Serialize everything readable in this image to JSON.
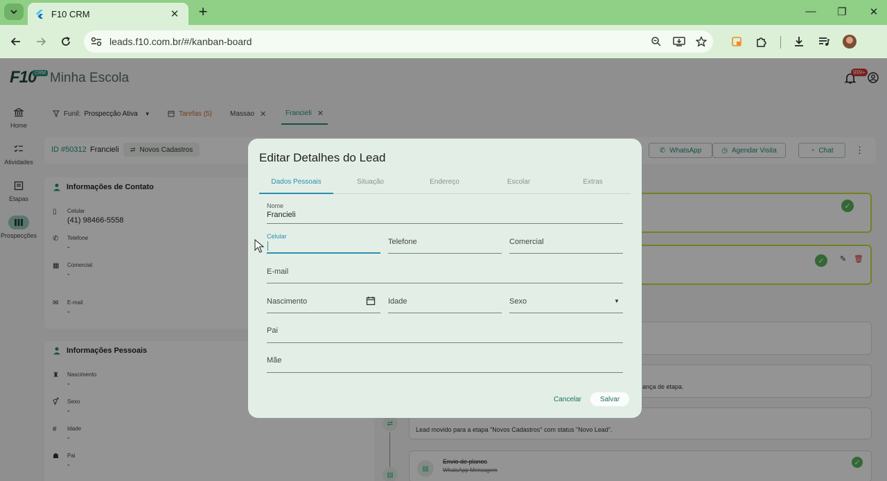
{
  "browser": {
    "tab_title": "F10 CRM",
    "url": "leads.f10.com.br/#/kanban-board"
  },
  "app": {
    "logo_text": "F10",
    "logo_badge": "CRM",
    "title": "Minha Escola",
    "notification_count": "999+",
    "sidebar": [
      {
        "label": "Home",
        "icon": "bank-icon"
      },
      {
        "label": "Atividades",
        "icon": "checklist-icon"
      },
      {
        "label": "Etapas",
        "icon": "board-icon"
      },
      {
        "label": "Prospecções",
        "icon": "columns-icon"
      }
    ],
    "tabs": {
      "funnel_label": "Funil:",
      "funnel_value": "Prospecção Ativa",
      "tarefas": "Tarefas (5)",
      "massao": "Massao",
      "francieli": "Francieli"
    },
    "lead": {
      "id": "ID #50312",
      "name": "Francieli",
      "stage_chip": "Novos Cadastros",
      "actions": {
        "whatsapp": "WhatsApp",
        "agendar": "Agendar Visita",
        "chat": "Chat"
      }
    },
    "contact": {
      "title": "Informações de Contato",
      "fields": [
        {
          "label": "Celular",
          "value": "(41) 98466-5558"
        },
        {
          "label": "Telefone",
          "value": "-"
        },
        {
          "label": "Comercial",
          "value": "-"
        },
        {
          "label": "E-mail",
          "value": "-"
        }
      ]
    },
    "personal": {
      "title": "Informações Pessoais",
      "fields": [
        {
          "label": "Nascimento",
          "value": "-"
        },
        {
          "label": "Sexo",
          "value": "-"
        },
        {
          "label": "Idade",
          "value": "-"
        },
        {
          "label": "Pai",
          "value": "-"
        }
      ]
    },
    "timeline": {
      "stage_change_text": "ança de etapa.",
      "move_text": "Lead movido para a etapa \"Novos Cadastros\" com status \"Novo Lead\".",
      "plan_title": "Envio de planos",
      "plan_sub": "WhatsApp Mensagem"
    }
  },
  "dialog": {
    "title": "Editar Detalhes do Lead",
    "tabs": [
      "Dados Pessoais",
      "Situação",
      "Endereço",
      "Escolar",
      "Extras"
    ],
    "fields": {
      "nome_label": "Nome",
      "nome_value": "Francieli",
      "celular_label": "Celular",
      "telefone_label": "Telefone",
      "comercial_label": "Comercial",
      "email_label": "E-mail",
      "nascimento_label": "Nascimento",
      "idade_label": "Idade",
      "sexo_label": "Sexo",
      "pai_label": "Pai",
      "mae_label": "Mãe"
    },
    "cancel": "Cancelar",
    "save": "Salvar"
  },
  "colors": {
    "accent": "#1d8f7a",
    "focus": "#2a8fb0",
    "chrome": "#8fcf86",
    "notification": "#d32f2f"
  }
}
